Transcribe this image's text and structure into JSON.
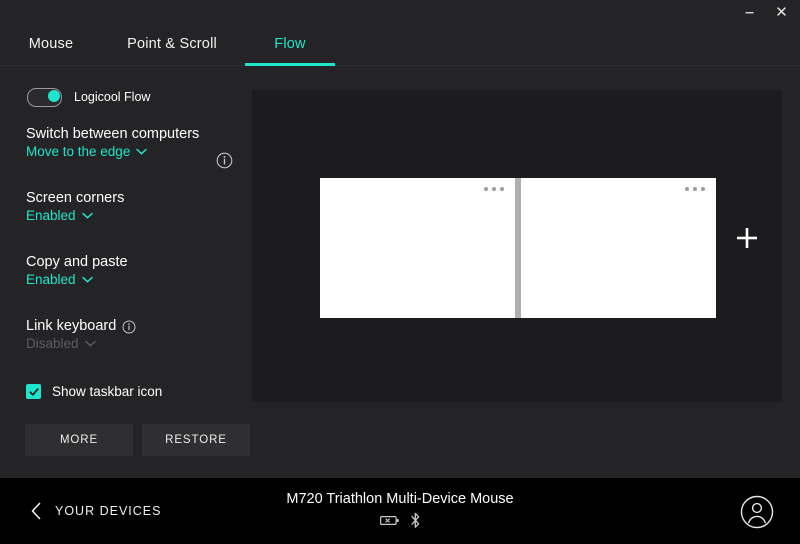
{
  "window": {
    "minimize_label": "–",
    "close_label": "×",
    "minimize_icon": "minimize-icon",
    "close_icon": "close-icon"
  },
  "tabs": [
    {
      "label": "Mouse",
      "active": false
    },
    {
      "label": "Point & Scroll",
      "active": false
    },
    {
      "label": "Flow",
      "active": true
    }
  ],
  "accent_color": "#1ee5cb",
  "sidebar": {
    "flow_toggle": {
      "label": "Logicool Flow",
      "state": "on",
      "info_icon": "info-icon"
    },
    "settings": [
      {
        "title": "Switch between computers",
        "value": "Move to the edge",
        "enabled": true
      },
      {
        "title": "Screen corners",
        "value": "Enabled",
        "enabled": true
      },
      {
        "title": "Copy and paste",
        "value": "Enabled",
        "enabled": true
      },
      {
        "title": "Link keyboard",
        "value": "Disabled",
        "enabled": false,
        "has_info": true
      }
    ],
    "checkbox": {
      "label": "Show taskbar icon",
      "checked": true
    },
    "buttons": [
      {
        "label": "MORE"
      },
      {
        "label": "RESTORE"
      }
    ]
  },
  "main": {
    "screens": [
      {
        "menu_icon": "more-dots-icon"
      },
      {
        "menu_icon": "more-dots-icon"
      }
    ],
    "add_button_icon": "plus-icon"
  },
  "footer": {
    "back_label": "YOUR DEVICES",
    "back_icon": "chevron-left-icon",
    "device_name": "M720 Triathlon Multi-Device Mouse",
    "battery_icon": "battery-empty-icon",
    "bluetooth_icon": "bluetooth-icon",
    "account_icon": "user-avatar-icon"
  }
}
